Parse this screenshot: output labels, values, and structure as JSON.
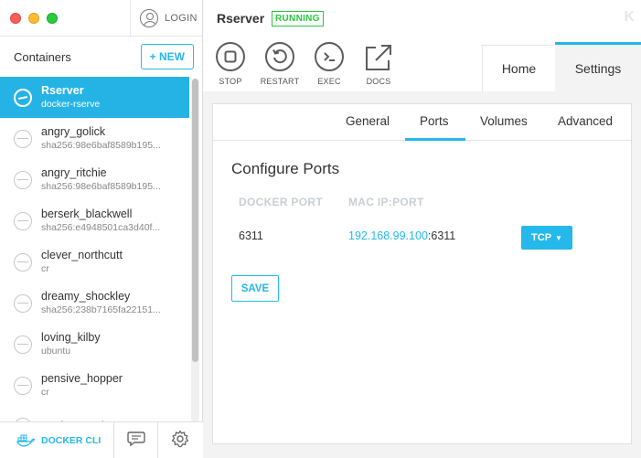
{
  "window": {
    "login_label": "LOGIN"
  },
  "sidebar": {
    "title": "Containers",
    "new_button": "+ NEW",
    "items": [
      {
        "name": "Rserver",
        "sub": "docker-rserve",
        "active": true
      },
      {
        "name": "angry_golick",
        "sub": "sha256:98e6baf8589b195..."
      },
      {
        "name": "angry_ritchie",
        "sub": "sha256:98e6baf8589b195..."
      },
      {
        "name": "berserk_blackwell",
        "sub": "sha256:e4948501ca3d40f..."
      },
      {
        "name": "clever_northcutt",
        "sub": "cr"
      },
      {
        "name": "dreamy_shockley",
        "sub": "sha256:238b7165fa22151..."
      },
      {
        "name": "loving_kilby",
        "sub": "ubuntu"
      },
      {
        "name": "pensive_hopper",
        "sub": "cr"
      },
      {
        "name": "tender_austin",
        "sub": ""
      }
    ],
    "bottom": {
      "docker_cli": "DOCKER CLI"
    }
  },
  "header": {
    "container_name": "Rserver",
    "status": "RUNNING",
    "logo": "K",
    "tools": {
      "stop": "STOP",
      "restart": "RESTART",
      "exec": "EXEC",
      "docs": "DOCS"
    },
    "tabs": {
      "home": "Home",
      "settings": "Settings"
    }
  },
  "settings": {
    "subtabs": {
      "general": "General",
      "ports": "Ports",
      "volumes": "Volumes",
      "advanced": "Advanced"
    },
    "title": "Configure Ports",
    "columns": {
      "docker_port": "DOCKER PORT",
      "mac_ip_port": "MAC IP:PORT"
    },
    "row": {
      "docker_port": "6311",
      "ip": "192.168.99.100",
      "port_suffix": ":6311",
      "protocol": "TCP"
    },
    "save": "SAVE"
  },
  "colors": {
    "accent": "#24b8eb",
    "running": "#28c840"
  }
}
